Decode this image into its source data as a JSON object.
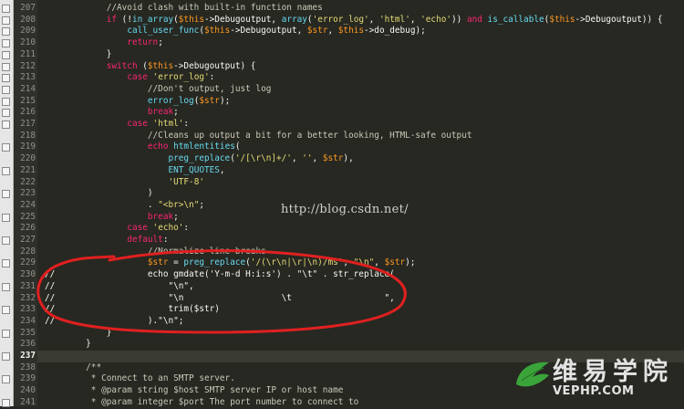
{
  "colors": {
    "background": "#272822",
    "keyword": "#f92672",
    "string": "#e6db74",
    "variable": "#fd971f",
    "function": "#66d9ef",
    "comment": "#75715e",
    "annotation": "#e02020",
    "logo_green": "#3aa43a"
  },
  "editor": {
    "current_line": "237",
    "lines": [
      {
        "n": "207",
        "tokens": [
          {
            "t": "            ",
            "c": "plain"
          },
          {
            "t": "//Avoid clash with built-in function names",
            "c": "dc"
          }
        ]
      },
      {
        "n": "208",
        "tokens": [
          {
            "t": "            ",
            "c": "plain"
          },
          {
            "t": "if",
            "c": "kw"
          },
          {
            "t": " (!",
            "c": "op"
          },
          {
            "t": "in_array",
            "c": "fn"
          },
          {
            "t": "(",
            "c": "op"
          },
          {
            "t": "$this",
            "c": "var"
          },
          {
            "t": "->Debugoutput, ",
            "c": "op"
          },
          {
            "t": "array",
            "c": "fn"
          },
          {
            "t": "(",
            "c": "op"
          },
          {
            "t": "'error_log'",
            "c": "str"
          },
          {
            "t": ", ",
            "c": "op"
          },
          {
            "t": "'html'",
            "c": "str"
          },
          {
            "t": ", ",
            "c": "op"
          },
          {
            "t": "'echo'",
            "c": "str"
          },
          {
            "t": ")) ",
            "c": "op"
          },
          {
            "t": "and",
            "c": "kw"
          },
          {
            "t": " ",
            "c": "op"
          },
          {
            "t": "is_callable",
            "c": "fn"
          },
          {
            "t": "(",
            "c": "op"
          },
          {
            "t": "$this",
            "c": "var"
          },
          {
            "t": "->Debugoutput)) {",
            "c": "op"
          }
        ]
      },
      {
        "n": "209",
        "tokens": [
          {
            "t": "                ",
            "c": "plain"
          },
          {
            "t": "call_user_func",
            "c": "fn"
          },
          {
            "t": "(",
            "c": "op"
          },
          {
            "t": "$this",
            "c": "var"
          },
          {
            "t": "->Debugoutput, ",
            "c": "op"
          },
          {
            "t": "$str",
            "c": "var"
          },
          {
            "t": ", ",
            "c": "op"
          },
          {
            "t": "$this",
            "c": "var"
          },
          {
            "t": "->do_debug);",
            "c": "op"
          }
        ]
      },
      {
        "n": "210",
        "tokens": [
          {
            "t": "                ",
            "c": "plain"
          },
          {
            "t": "return",
            "c": "kw"
          },
          {
            "t": ";",
            "c": "op"
          }
        ]
      },
      {
        "n": "211",
        "tokens": [
          {
            "t": "            }",
            "c": "op"
          }
        ]
      },
      {
        "n": "212",
        "tokens": [
          {
            "t": "            ",
            "c": "plain"
          },
          {
            "t": "switch",
            "c": "kw"
          },
          {
            "t": " (",
            "c": "op"
          },
          {
            "t": "$this",
            "c": "var"
          },
          {
            "t": "->Debugoutput) {",
            "c": "op"
          }
        ]
      },
      {
        "n": "213",
        "tokens": [
          {
            "t": "                ",
            "c": "plain"
          },
          {
            "t": "case",
            "c": "kw"
          },
          {
            "t": " ",
            "c": "op"
          },
          {
            "t": "'error_log'",
            "c": "str"
          },
          {
            "t": ":",
            "c": "op"
          }
        ]
      },
      {
        "n": "214",
        "tokens": [
          {
            "t": "                    ",
            "c": "plain"
          },
          {
            "t": "//Don't output, just log",
            "c": "dc"
          }
        ]
      },
      {
        "n": "215",
        "tokens": [
          {
            "t": "                    ",
            "c": "plain"
          },
          {
            "t": "error_log",
            "c": "fn"
          },
          {
            "t": "(",
            "c": "op"
          },
          {
            "t": "$str",
            "c": "var"
          },
          {
            "t": ");",
            "c": "op"
          }
        ]
      },
      {
        "n": "216",
        "tokens": [
          {
            "t": "                    ",
            "c": "plain"
          },
          {
            "t": "break",
            "c": "kw"
          },
          {
            "t": ";",
            "c": "op"
          }
        ]
      },
      {
        "n": "217",
        "tokens": [
          {
            "t": "                ",
            "c": "plain"
          },
          {
            "t": "case",
            "c": "kw"
          },
          {
            "t": " ",
            "c": "op"
          },
          {
            "t": "'html'",
            "c": "str"
          },
          {
            "t": ":",
            "c": "op"
          }
        ]
      },
      {
        "n": "218",
        "tokens": [
          {
            "t": "                    ",
            "c": "plain"
          },
          {
            "t": "//Cleans up output a bit for a better looking, HTML-safe output",
            "c": "dc"
          }
        ]
      },
      {
        "n": "219",
        "tokens": [
          {
            "t": "                    ",
            "c": "plain"
          },
          {
            "t": "echo",
            "c": "kw"
          },
          {
            "t": " ",
            "c": "op"
          },
          {
            "t": "htmlentities",
            "c": "fn"
          },
          {
            "t": "(",
            "c": "op"
          }
        ]
      },
      {
        "n": "220",
        "tokens": [
          {
            "t": "                        ",
            "c": "plain"
          },
          {
            "t": "preg_replace",
            "c": "fn"
          },
          {
            "t": "(",
            "c": "op"
          },
          {
            "t": "'/[\\r\\n]+/'",
            "c": "str"
          },
          {
            "t": ", ",
            "c": "op"
          },
          {
            "t": "''",
            "c": "str"
          },
          {
            "t": ", ",
            "c": "op"
          },
          {
            "t": "$str",
            "c": "var"
          },
          {
            "t": "),",
            "c": "op"
          }
        ]
      },
      {
        "n": "221",
        "tokens": [
          {
            "t": "                        ",
            "c": "plain"
          },
          {
            "t": "ENT_QUOTES",
            "c": "fn"
          },
          {
            "t": ",",
            "c": "op"
          }
        ]
      },
      {
        "n": "222",
        "tokens": [
          {
            "t": "                        ",
            "c": "plain"
          },
          {
            "t": "'UTF-8'",
            "c": "str"
          }
        ]
      },
      {
        "n": "223",
        "tokens": [
          {
            "t": "                    )",
            "c": "op"
          }
        ]
      },
      {
        "n": "224",
        "tokens": [
          {
            "t": "                    . ",
            "c": "op"
          },
          {
            "t": "\"<br>\\n\"",
            "c": "str"
          },
          {
            "t": ";",
            "c": "op"
          }
        ]
      },
      {
        "n": "225",
        "tokens": [
          {
            "t": "                    ",
            "c": "plain"
          },
          {
            "t": "break",
            "c": "kw"
          },
          {
            "t": ";",
            "c": "op"
          }
        ]
      },
      {
        "n": "226",
        "tokens": [
          {
            "t": "                ",
            "c": "plain"
          },
          {
            "t": "case",
            "c": "kw"
          },
          {
            "t": " ",
            "c": "op"
          },
          {
            "t": "'echo'",
            "c": "str"
          },
          {
            "t": ":",
            "c": "op"
          }
        ]
      },
      {
        "n": "227",
        "tokens": [
          {
            "t": "                ",
            "c": "plain"
          },
          {
            "t": "default",
            "c": "kw"
          },
          {
            "t": ":",
            "c": "op"
          }
        ]
      },
      {
        "n": "228",
        "tokens": [
          {
            "t": "                    ",
            "c": "plain"
          },
          {
            "t": "//Normalize line breaks",
            "c": "dc"
          }
        ]
      },
      {
        "n": "229",
        "tokens": [
          {
            "t": "                    ",
            "c": "plain"
          },
          {
            "t": "$str",
            "c": "var"
          },
          {
            "t": " = ",
            "c": "op"
          },
          {
            "t": "preg_replace",
            "c": "fn"
          },
          {
            "t": "(",
            "c": "op"
          },
          {
            "t": "'/(\\r\\n|\\r|\\n)/ms'",
            "c": "str"
          },
          {
            "t": ", ",
            "c": "op"
          },
          {
            "t": "\"\\n\"",
            "c": "str"
          },
          {
            "t": ", ",
            "c": "op"
          },
          {
            "t": "$str",
            "c": "var"
          },
          {
            "t": ");",
            "c": "op"
          }
        ]
      },
      {
        "n": "230",
        "tokens": [
          {
            "t": "//                  echo gmdate('Y-m-d H:i:s') . \"\\t\" . str_replace(",
            "c": "plain"
          }
        ]
      },
      {
        "n": "231",
        "tokens": [
          {
            "t": "//                      \"\\n\",",
            "c": "plain"
          }
        ]
      },
      {
        "n": "232",
        "tokens": [
          {
            "t": "//                      \"\\n                   \\t                  \",",
            "c": "plain"
          }
        ]
      },
      {
        "n": "233",
        "tokens": [
          {
            "t": "//                      trim($str)",
            "c": "plain"
          }
        ]
      },
      {
        "n": "234",
        "tokens": [
          {
            "t": "//                  ).\"\\n\";",
            "c": "plain"
          }
        ]
      },
      {
        "n": "235",
        "tokens": [
          {
            "t": "            }",
            "c": "op"
          }
        ]
      },
      {
        "n": "236",
        "tokens": [
          {
            "t": "        }",
            "c": "op"
          }
        ]
      },
      {
        "n": "237",
        "tokens": [
          {
            "t": "",
            "c": "plain"
          }
        ]
      },
      {
        "n": "238",
        "tokens": [
          {
            "t": "        ",
            "c": "plain"
          },
          {
            "t": "/**",
            "c": "dc"
          }
        ]
      },
      {
        "n": "239",
        "tokens": [
          {
            "t": "         * Connect to an SMTP server.",
            "c": "dc"
          }
        ]
      },
      {
        "n": "240",
        "tokens": [
          {
            "t": "         * @param string $host SMTP server IP or host name",
            "c": "dc"
          }
        ]
      },
      {
        "n": "241",
        "tokens": [
          {
            "t": "         * @param integer $port The port number to connect to",
            "c": "dc"
          }
        ]
      }
    ]
  },
  "watermark": "http://blog.csdn.net/",
  "logo": {
    "title": "维易学院",
    "subtitle": "VEPHP.COM"
  }
}
